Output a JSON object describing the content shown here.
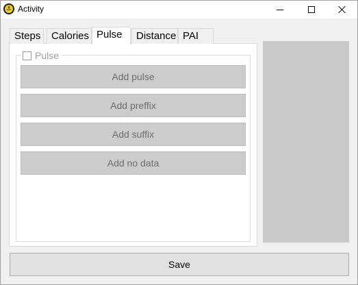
{
  "window": {
    "title": "Activity",
    "app_icon": "activity-app-icon",
    "app_icon_glyph": "⚓"
  },
  "tabs": [
    {
      "label": "Steps",
      "active": false
    },
    {
      "label": "Calories",
      "active": false
    },
    {
      "label": "Pulse",
      "active": true
    },
    {
      "label": "Distance",
      "active": false
    },
    {
      "label": "PAI",
      "active": false
    }
  ],
  "pulse_group": {
    "checkbox_label": "Pulse",
    "checked": false,
    "buttons": [
      {
        "label": "Add pulse"
      },
      {
        "label": "Add preffix"
      },
      {
        "label": "Add suffix"
      },
      {
        "label": "Add no data"
      }
    ]
  },
  "footer": {
    "save_label": "Save"
  },
  "colors": {
    "window_bg": "#f0f0f0",
    "panel_bg": "#ffffff",
    "button_bg": "#cccccc",
    "button_text": "#6d6d6d",
    "side_panel": "#c9c9c9",
    "app_icon_yellow": "#f2d21b"
  }
}
